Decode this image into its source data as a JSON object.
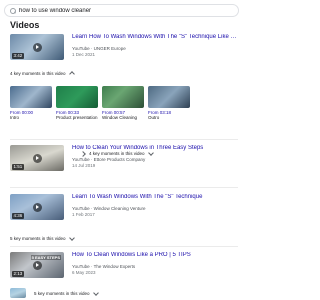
{
  "search": {
    "query": "how to use window cleaner"
  },
  "section_title": "Videos",
  "results": [
    {
      "title": "Learn How To Wash Windows With The \"S\" Technique Like a ...",
      "source": "YouTube · UNGER Europe",
      "date": "1 Dec 2021",
      "duration": "3:42",
      "moments_label": "4 key moments in this video"
    },
    {
      "title": "How to Clean Your Windows in Three Easy Steps",
      "source": "YouTube · Ettore Products Company",
      "date": "14 Jul 2019",
      "duration": "1:51",
      "moments_label": "4 key moments in this video"
    },
    {
      "title": "Learn To Wash Windows With The \"S\" Technique",
      "source": "YouTube · Window Cleaning Venture",
      "date": "1 Feb 2017",
      "duration": "4:36",
      "moments_label": "5 key moments in this video"
    },
    {
      "title": "How To Clean Windows Like a PRO | 5 TIPS",
      "source": "YouTube · The Window Experts",
      "date": "6 May 2023",
      "duration": "2:13",
      "thumb_text": "5 EASY STEPS",
      "moments_label": "5 key moments in this video"
    }
  ],
  "key_moments": [
    {
      "time": "From 00:00",
      "label": "Intro"
    },
    {
      "time": "From 00:33",
      "label": "Product presentation"
    },
    {
      "time": "From 00:57",
      "label": "Window Cleaning"
    },
    {
      "time": "From 03:18",
      "label": "Outro"
    }
  ]
}
